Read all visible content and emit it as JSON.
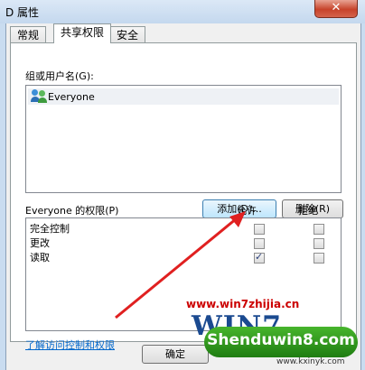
{
  "window": {
    "title": "D 属性",
    "close_glyph": "✕"
  },
  "tabs": [
    {
      "label": "常规"
    },
    {
      "label": "共享权限",
      "active": true
    },
    {
      "label": "安全"
    }
  ],
  "group_section": {
    "label": "组或用户名(G):",
    "items": [
      {
        "name": "Everyone",
        "icon": "users-group-icon"
      }
    ]
  },
  "buttons": {
    "add": "添加(D)...",
    "remove": "删除(R)",
    "ok": "确定"
  },
  "permissions": {
    "header": "Everyone 的权限(P)",
    "allow_header": "允许",
    "deny_header": "拒绝",
    "rows": [
      {
        "label": "完全控制",
        "allow": false,
        "deny": false
      },
      {
        "label": "更改",
        "allow": false,
        "deny": false
      },
      {
        "label": "读取",
        "allow": true,
        "deny": false
      }
    ]
  },
  "help_link": "了解访问控制和权限",
  "watermark": {
    "url": "www.win7zhijia.cn",
    "logo": "WIN7",
    "badge": "Shenduwin8.com",
    "site": "www.kxinyk.com"
  },
  "colors": {
    "arrow": "#e02020",
    "link": "#0066cc",
    "titlebar": "#c4d8ee"
  }
}
